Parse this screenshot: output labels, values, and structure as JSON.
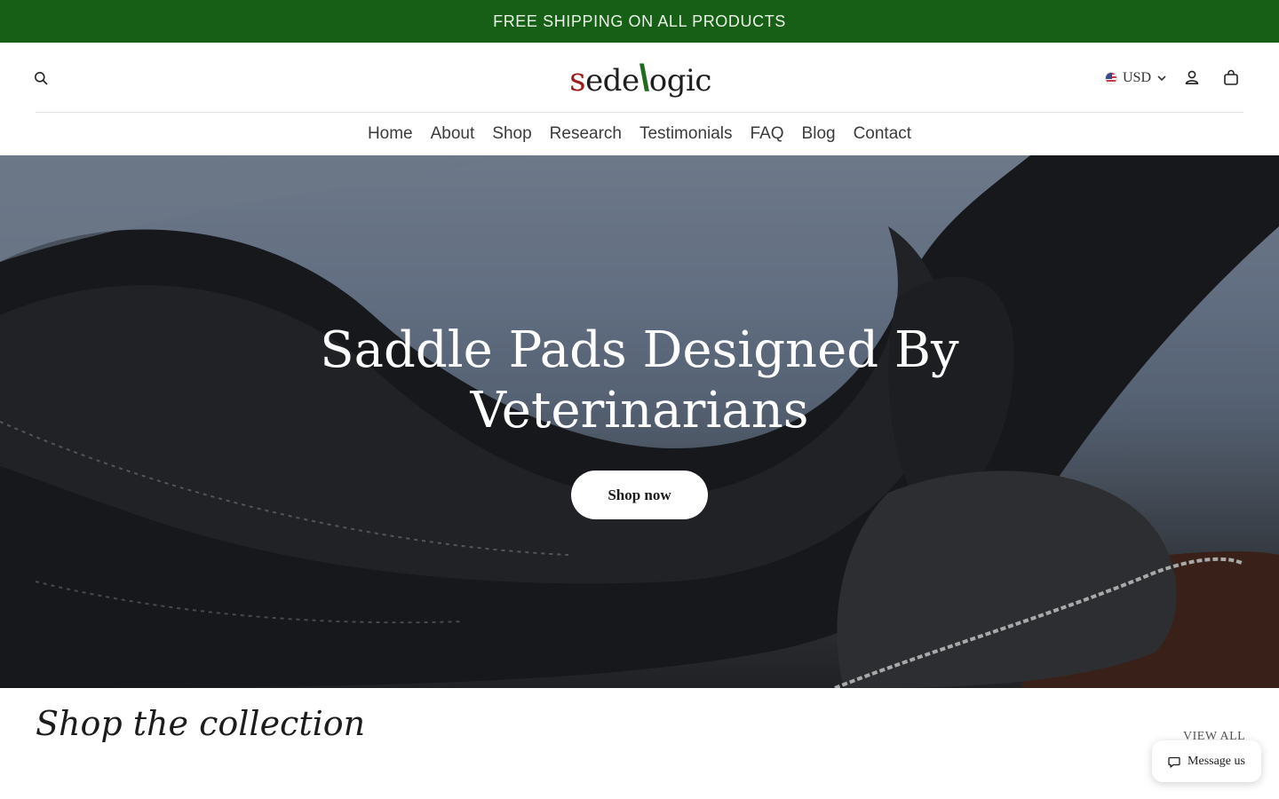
{
  "announcement": {
    "text": "FREE SHIPPING ON ALL PRODUCTS",
    "background": "#175e16"
  },
  "header": {
    "logo": {
      "s": "s",
      "mid": "ede",
      "slash": "\\",
      "end": "ogic",
      "accent_red": "#9a1e1e",
      "accent_green": "#1f6b1f"
    },
    "currency": {
      "code": "USD",
      "flag_icon": "us-flag-icon"
    },
    "icons": [
      "search-icon",
      "account-icon",
      "cart-icon",
      "chevron-down-icon"
    ]
  },
  "nav": {
    "items": [
      {
        "label": "Home"
      },
      {
        "label": "About"
      },
      {
        "label": "Shop"
      },
      {
        "label": "Research"
      },
      {
        "label": "Testimonials"
      },
      {
        "label": "FAQ"
      },
      {
        "label": "Blog"
      },
      {
        "label": "Contact"
      }
    ]
  },
  "hero": {
    "title": "Saddle Pads Designed By Veterinarians",
    "cta_label": "Shop now"
  },
  "collection": {
    "title": "Shop the collection",
    "view_all_label": "VIEW ALL"
  },
  "chat": {
    "label": "Message us",
    "icon": "chat-bubble-icon"
  }
}
